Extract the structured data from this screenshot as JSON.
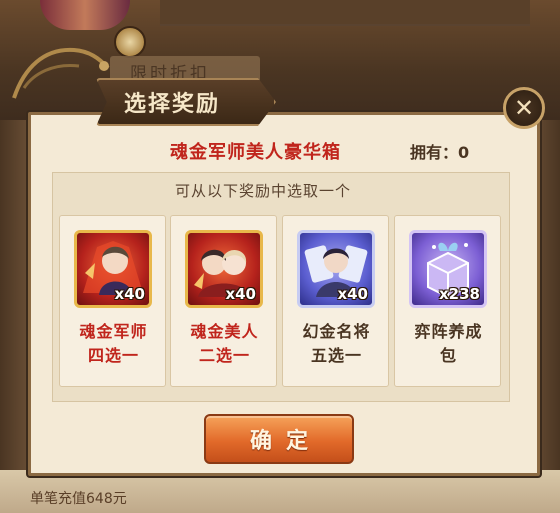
{
  "background": {
    "banner_text": "限时折扣",
    "bottom_text": "单笔充值648元"
  },
  "dialog": {
    "title": "选择奖励",
    "chest_name": "魂金军师美人豪华箱",
    "own_label": "拥有：",
    "own_count": "0",
    "instruction": "可从以下奖励中选取一个",
    "confirm_label": "确定"
  },
  "rewards": [
    {
      "icon": "red-portrait-fan-icon",
      "count": "x40",
      "label_line1": "魂金军师",
      "label_line2": "四选一",
      "label_color": "#c0251c"
    },
    {
      "icon": "red-portrait-pair-icon",
      "count": "x40",
      "label_line1": "魂金美人",
      "label_line2": "二选一",
      "label_color": "#c0251c"
    },
    {
      "icon": "blue-portrait-cards-icon",
      "count": "x40",
      "label_line1": "幻金名将",
      "label_line2": "五选一",
      "label_color": "#4a3522"
    },
    {
      "icon": "purple-gift-box-icon",
      "count": "x238",
      "label_line1": "弈阵养成",
      "label_line2": "包",
      "label_color": "#4a3522"
    }
  ],
  "colors": {
    "accent_red": "#c0251c",
    "panel_bg": "#f4ead6",
    "button_orange": "#e26a2a"
  }
}
